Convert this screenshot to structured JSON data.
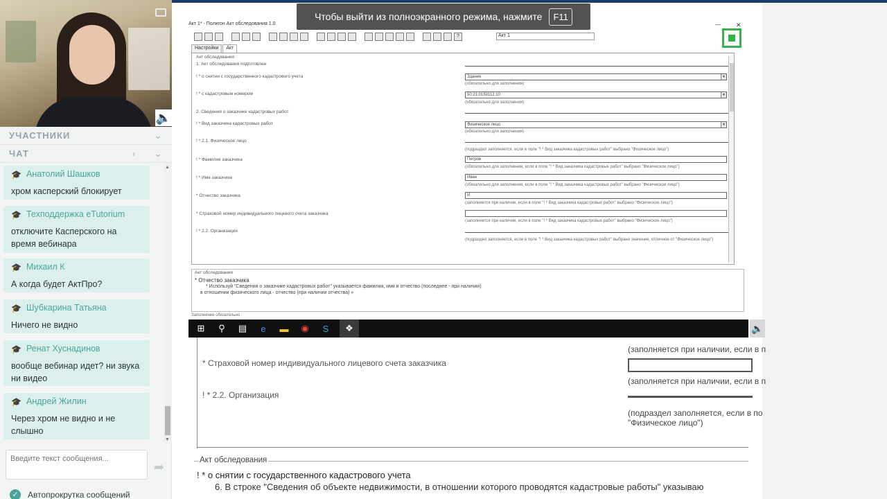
{
  "sidebar": {
    "participants_label": "УЧАСТНИКИ",
    "chat_label": "ЧАТ",
    "messages": [
      {
        "author": "Анатолий Шашков",
        "text": "хром касперский блокирует"
      },
      {
        "author": "Техподдержка eTutorium",
        "text": "отключите Касперского на время вебинара"
      },
      {
        "author": "Михаил К",
        "text": "А когда будет АктПро?"
      },
      {
        "author": "Шубкарина Татьяна",
        "text": "Ничего не видно"
      },
      {
        "author": "Ренат Хуснадинов",
        "text": "вообще вебинар идет? ни звука ни видео"
      },
      {
        "author": "Андрей Жилин",
        "text": "Через хром не видно и не слышно"
      }
    ],
    "input_placeholder": "Введите текст сообщения...",
    "autoscroll_label": "Автопрокрутка сообщений"
  },
  "banner": {
    "text": "Чтобы выйти из полноэкранного режима, нажмите",
    "key": "F11"
  },
  "program": {
    "title": "Акт 1* - Полигон Акт обследования 1.0",
    "toolbar_field": "Акт 1",
    "tabs": [
      "Настройки",
      "Акт"
    ],
    "form": {
      "legend": "Акт обследования",
      "section1": "1. Акт обследования подготовлен",
      "row_cancel": "! * о снятии с государственного кадастрового учета",
      "row_cancel_value": "Здание",
      "row_cancel_hint": "(обязательно для заполнения)",
      "row_cadnum": "! * с кадастровым номером",
      "row_cadnum_value": "50:21:0150112:10",
      "row_cadnum_hint": "(обязательно для заполнения)",
      "section2": "2. Сведения о заказчике кадастровых работ",
      "row_customer_type": "! * Вид заказчика кадастровых работ",
      "row_customer_type_value": "Физическое лицо",
      "row_customer_type_hint": "(обязательно для заполнения)",
      "section21": "! * 2.1. Физическое лицо",
      "section21_hint": "(подраздел заполняется, если в поле \"! * Вид заказчика кадастровых работ\" выбрано \"Физическое лицо\")",
      "row_lastname": "! * Фамилия заказчика",
      "row_lastname_value": "Петров",
      "row_lastname_hint": "(обязательно для заполнения, если в поле \"! * Вид заказчика кадастровых работ\" выбрано \"Физическое лицо\")",
      "row_firstname": "! * Имя заказчика",
      "row_firstname_value": "Иван",
      "row_firstname_hint": "(обязательно для заполнения, если в поле \"! * Вид заказчика кадастровых работ\" выбрано \"Физическое лицо\")",
      "row_patronymic": "* Отчество заказчика",
      "row_patronymic_value": "И",
      "row_patronymic_hint": "(заполняется при наличии, если в поле \"! * Вид заказчика кадастровых работ\" выбрано \"Физическое лицо\")",
      "row_snils": "* Страховой номер индивидуального лицевого счета заказчика",
      "row_snils_hint": "(заполняется при наличии, если в поле \"! * Вид заказчика кадастровых работ\" выбрано \"Физическое лицо\")",
      "section22": "! * 2.2. Организация",
      "section22_hint": "(подраздел заполняется, если в поле \"! * Вид заказчика кадастровых работ\" выбрано значение, отличное от \"Физическое лицо\")"
    },
    "notes": {
      "legend": "Акт обследования",
      "line1": "* Отчество заказчика",
      "line2": "* Используй \"Сведения о заказчике кадастровых работ\" указывается фамилия, имя и отчество (последнее - при наличии)",
      "line3": "в отношении физического лица - отчество (при наличии отчества) »"
    },
    "status": "Заполнение обязательно"
  },
  "zoomed": {
    "hint_top": "(заполняется при наличии, если в п",
    "row_snils": "* Страховой номер индивидуального лицевого счета заказчика",
    "hint_mid": "(заполняется при наличии, если в п",
    "section22": "! * 2.2. Организация",
    "hint_bottom_1": "(подраздел заполняется, если в по",
    "hint_bottom_2": "\"Физическое лицо\")",
    "notes_legend": "Акт обследования",
    "notes_line1": "! * о снятии с государственного кадастрового учета",
    "notes_line2": "6. В строке \"Сведения об объекте недвижимости, в отношении которого проводятся кадастровые работы\" указываю"
  }
}
